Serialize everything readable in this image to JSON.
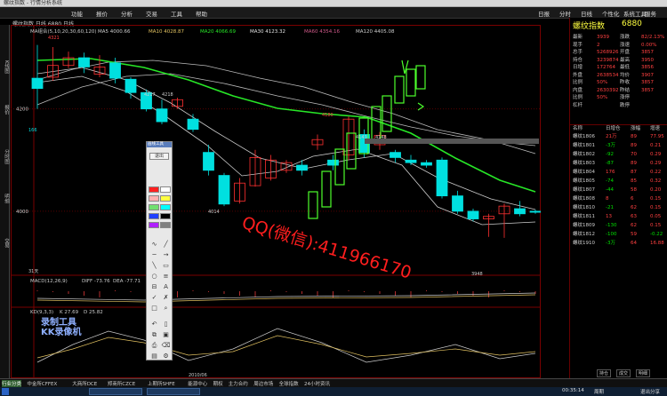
{
  "window": {
    "title": "螺纹指数 - 行情分析系统"
  },
  "menu": [
    "功能",
    "报价",
    "分析",
    "交易",
    "工具",
    "帮助"
  ],
  "right_menu": [
    "日报",
    "分时",
    "日线",
    "个性化",
    "系统工具",
    "服务"
  ],
  "chart_info": "螺纹指数 日线 6880 日线",
  "ma_legend": {
    "label": "MA组合(5,10,20,30,60,120)",
    "items": [
      {
        "text": "MA5 4000.66",
        "color": "#cccccc"
      },
      {
        "text": "MA10 4028.87",
        "color": "#e0c060"
      },
      {
        "text": "MA20 4066.69",
        "color": "#27e627"
      },
      {
        "text": "MA30 4123.32",
        "color": "#e0e0e0"
      },
      {
        "text": "MA60 4354.16",
        "color": "#d05a8a"
      },
      {
        "text": "MA120 4405.08",
        "color": "#cccccc"
      }
    ]
  },
  "price_labels": {
    "high_4321": "4321",
    "v_4217": "4217",
    "v_4218": "4218",
    "v_4014": "4014",
    "v_4180": "4180",
    "v_4143": "4143",
    "v_4148": "4148",
    "low_3948": "3948",
    "v_166": "166"
  },
  "y_ticks": [
    {
      "value": "4200",
      "color": "#cccccc"
    },
    {
      "value": "4000",
      "color": "#cccccc"
    }
  ],
  "volume_label": "31天",
  "macd": {
    "label": "MACD(12,26,9)",
    "diff": "DIFF -73.76",
    "dea": "DEA -77.71"
  },
  "kdj": {
    "label": "KD(9,3,3)",
    "k": "K 27.69",
    "d": "D 25.82"
  },
  "date_label": "2010/06",
  "right_panel": {
    "title": "螺纹指数",
    "code": "6880",
    "rows": [
      {
        "l1": "最新",
        "v1": "3939",
        "l2": "涨跌",
        "v2": "82/2.13%"
      },
      {
        "l1": "现手",
        "v1": "2",
        "l2": "涨速",
        "v2": "0.00%"
      },
      {
        "l1": "总手",
        "v1": "5268926",
        "l2": "开盘",
        "v2": "3857"
      },
      {
        "l1": "持仓",
        "v1": "3239874",
        "l2": "最高",
        "v2": "3950"
      },
      {
        "l1": "日增",
        "v1": "172764",
        "l2": "最低",
        "v2": "3856"
      },
      {
        "l1": "外盘",
        "v1": "2638534",
        "l2": "均价",
        "v2": "3907"
      },
      {
        "l1": "比例",
        "v1": "50%",
        "l2": "昨收",
        "v2": "3857"
      },
      {
        "l1": "内盘",
        "v1": "2630392",
        "l2": "昨结",
        "v2": "3857"
      },
      {
        "l1": "比例",
        "v1": "50%",
        "l2": "涨停",
        "v2": ""
      },
      {
        "l1": "杠杆",
        "v1": "",
        "l2": "跌停",
        "v2": ""
      }
    ],
    "table_header": [
      "名称",
      "日增仓",
      "涨幅",
      "增速"
    ],
    "table": [
      [
        "螺纹1806",
        "21万",
        "89",
        "77.95"
      ],
      [
        "螺纹1801",
        "-3万",
        "89",
        "0.21"
      ],
      [
        "螺纹1802",
        "-92",
        "70",
        "0.29"
      ],
      [
        "螺纹1803",
        "-87",
        "89",
        "0.29"
      ],
      [
        "螺纹1804",
        "176",
        "87",
        "0.22"
      ],
      [
        "螺纹1805",
        "-74",
        "85",
        "0.32"
      ],
      [
        "螺纹1807",
        "-44",
        "58",
        "0.20"
      ],
      [
        "螺纹1808",
        "8",
        "6",
        "0.15"
      ],
      [
        "螺纹1810",
        "-21",
        "62",
        "0.15"
      ],
      [
        "螺纹1811",
        "13",
        "63",
        "0.05"
      ],
      [
        "螺纹1809",
        "-130",
        "62",
        "0.15"
      ],
      [
        "螺纹1812",
        "-100",
        "59",
        "-0.22"
      ],
      [
        "螺纹1910",
        "-3万",
        "64",
        "16.88"
      ]
    ],
    "bottom_tabs": [
      "持仓",
      "成交",
      "明细"
    ]
  },
  "bottom_tabs": [
    "行业分类",
    "中金所CFFEX",
    "大商所DCE",
    "郑商所CZCE",
    "上期所SHFE",
    "能源中心",
    "期权",
    "主力合约",
    "周边市场",
    "全球指数",
    "24小时资讯"
  ],
  "taskbar": {
    "time": "00:35:14",
    "btn_left": "周期",
    "btn_right": "退出分享"
  },
  "palette": {
    "title": "画线工具",
    "exit": "退出"
  },
  "watermark": "QQ(微信):411966170",
  "rec_logo": [
    "录制工具",
    "KK录像机"
  ],
  "chart_data": {
    "type": "candlestick",
    "series": [
      {
        "name": "MA5",
        "color": "#cccccc"
      },
      {
        "name": "MA10",
        "color": "#e0c060"
      },
      {
        "name": "MA20",
        "color": "#27e627"
      },
      {
        "name": "MA30",
        "color": "#e0e0e0"
      },
      {
        "name": "MA60",
        "color": "#d05a8a"
      },
      {
        "name": "MA120",
        "color": "#cccccc"
      }
    ],
    "ylim": [
      3920,
      4340
    ],
    "candles": [
      {
        "o": 4260,
        "c": 4240,
        "h": 4325,
        "l": 4200
      },
      {
        "o": 4262,
        "c": 4285,
        "h": 4321,
        "l": 4255
      },
      {
        "o": 4285,
        "c": 4300,
        "h": 4312,
        "l": 4280
      },
      {
        "o": 4300,
        "c": 4282,
        "h": 4310,
        "l": 4270
      },
      {
        "o": 4268,
        "c": 4282,
        "h": 4305,
        "l": 4262
      },
      {
        "o": 4290,
        "c": 4260,
        "h": 4300,
        "l": 4250
      },
      {
        "o": 4258,
        "c": 4232,
        "h": 4262,
        "l": 4220
      },
      {
        "o": 4232,
        "c": 4200,
        "h": 4238,
        "l": 4195
      },
      {
        "o": 4200,
        "c": 4175,
        "h": 4218,
        "l": 4170
      },
      {
        "o": 4205,
        "c": 4218,
        "h": 4222,
        "l": 4200
      },
      {
        "o": 4180,
        "c": 4160,
        "h": 4190,
        "l": 4155
      },
      {
        "o": 4115,
        "c": 4080,
        "h": 4130,
        "l": 4070
      },
      {
        "o": 4070,
        "c": 4014,
        "h": 4075,
        "l": 4010
      },
      {
        "o": 4020,
        "c": 4055,
        "h": 4065,
        "l": 4015
      },
      {
        "o": 4050,
        "c": 4105,
        "h": 4120,
        "l": 4048
      },
      {
        "o": 4065,
        "c": 4100,
        "h": 4110,
        "l": 4060
      },
      {
        "o": 4080,
        "c": 4095,
        "h": 4100,
        "l": 4075
      },
      {
        "o": 4090,
        "c": 4080,
        "h": 4100,
        "l": 4070
      },
      {
        "o": 4130,
        "c": 4140,
        "h": 4150,
        "l": 4120
      },
      {
        "o": 4100,
        "c": 4090,
        "h": 4110,
        "l": 4080
      },
      {
        "o": 4110,
        "c": 4180,
        "h": 4185,
        "l": 4100
      },
      {
        "o": 4150,
        "c": 4115,
        "h": 4160,
        "l": 4105
      },
      {
        "o": 4130,
        "c": 4148,
        "h": 4155,
        "l": 4120
      },
      {
        "o": 4115,
        "c": 4105,
        "h": 4120,
        "l": 4095
      },
      {
        "o": 4100,
        "c": 4095,
        "h": 4110,
        "l": 4090
      },
      {
        "o": 4095,
        "c": 4090,
        "h": 4100,
        "l": 4085
      },
      {
        "o": 4100,
        "c": 4030,
        "h": 4105,
        "l": 4025
      },
      {
        "o": 4030,
        "c": 4000,
        "h": 4040,
        "l": 3995
      },
      {
        "o": 4000,
        "c": 3985,
        "h": 4005,
        "l": 3980
      },
      {
        "o": 3985,
        "c": 3990,
        "h": 3995,
        "l": 3950
      },
      {
        "o": 3995,
        "c": 4010,
        "h": 4015,
        "l": 3948
      },
      {
        "o": 4005,
        "c": 3995,
        "h": 4020,
        "l": 3990
      },
      {
        "o": 4000,
        "c": 3998,
        "h": 4003,
        "l": 3995
      },
      {
        "o": 4000,
        "c": 3998,
        "h": 4010,
        "l": 3990
      }
    ]
  }
}
